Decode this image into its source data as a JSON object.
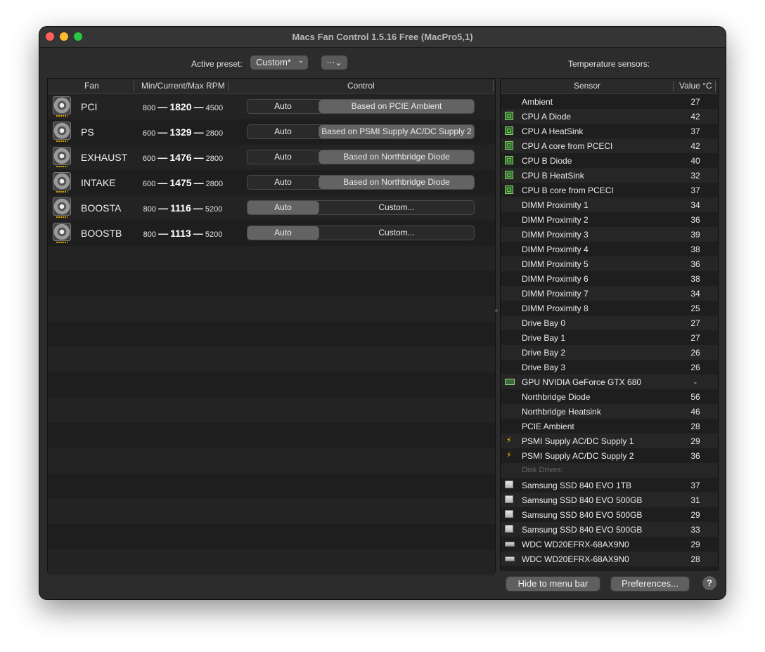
{
  "window": {
    "title": "Macs Fan Control 1.5.16 Free (MacPro5,1)"
  },
  "toolbar": {
    "active_preset_label": "Active preset:",
    "preset_value": "Custom*",
    "more_icon": "ellipsis-circle-icon",
    "temperature_label": "Temperature sensors:"
  },
  "fan_table": {
    "headers": {
      "fan": "Fan",
      "rpm": "Min/Current/Max RPM",
      "control": "Control"
    },
    "dash": "—",
    "fans": [
      {
        "name": "PCI",
        "min": "800",
        "current": "1820",
        "max": "4500",
        "auto_label": "Auto",
        "control_label": "Based on PCIE Ambient",
        "active": "sensor"
      },
      {
        "name": "PS",
        "min": "600",
        "current": "1329",
        "max": "2800",
        "auto_label": "Auto",
        "control_label": "Based on PSMI Supply AC/DC Supply 2",
        "active": "sensor"
      },
      {
        "name": "EXHAUST",
        "min": "600",
        "current": "1476",
        "max": "2800",
        "auto_label": "Auto",
        "control_label": "Based on Northbridge Diode",
        "active": "sensor"
      },
      {
        "name": "INTAKE",
        "min": "600",
        "current": "1475",
        "max": "2800",
        "auto_label": "Auto",
        "control_label": "Based on Northbridge Diode",
        "active": "sensor"
      },
      {
        "name": "BOOSTA",
        "min": "800",
        "current": "1116",
        "max": "5200",
        "auto_label": "Auto",
        "control_label": "Custom...",
        "active": "auto"
      },
      {
        "name": "BOOSTB",
        "min": "800",
        "current": "1113",
        "max": "5200",
        "auto_label": "Auto",
        "control_label": "Custom...",
        "active": "auto"
      }
    ]
  },
  "sensor_table": {
    "headers": {
      "sensor": "Sensor",
      "value": "Value °C"
    },
    "rows": [
      {
        "name": "Ambient",
        "value": "27",
        "icon": ""
      },
      {
        "name": "CPU A Diode",
        "value": "42",
        "icon": "chip"
      },
      {
        "name": "CPU A HeatSink",
        "value": "37",
        "icon": "chip"
      },
      {
        "name": "CPU A core from PCECI",
        "value": "42",
        "icon": "chip"
      },
      {
        "name": "CPU B Diode",
        "value": "40",
        "icon": "chip"
      },
      {
        "name": "CPU B HeatSink",
        "value": "32",
        "icon": "chip"
      },
      {
        "name": "CPU B core from PCECI",
        "value": "37",
        "icon": "chip"
      },
      {
        "name": "DIMM Proximity 1",
        "value": "34",
        "icon": ""
      },
      {
        "name": "DIMM Proximity 2",
        "value": "36",
        "icon": ""
      },
      {
        "name": "DIMM Proximity 3",
        "value": "39",
        "icon": ""
      },
      {
        "name": "DIMM Proximity 4",
        "value": "38",
        "icon": ""
      },
      {
        "name": "DIMM Proximity 5",
        "value": "36",
        "icon": ""
      },
      {
        "name": "DIMM Proximity 6",
        "value": "38",
        "icon": ""
      },
      {
        "name": "DIMM Proximity 7",
        "value": "34",
        "icon": ""
      },
      {
        "name": "DIMM Proximity 8",
        "value": "25",
        "icon": ""
      },
      {
        "name": "Drive Bay 0",
        "value": "27",
        "icon": ""
      },
      {
        "name": "Drive Bay 1",
        "value": "27",
        "icon": ""
      },
      {
        "name": "Drive Bay 2",
        "value": "26",
        "icon": ""
      },
      {
        "name": "Drive Bay 3",
        "value": "26",
        "icon": ""
      },
      {
        "name": "GPU NVIDIA GeForce GTX 680",
        "value": "-",
        "icon": "gpu"
      },
      {
        "name": "Northbridge Diode",
        "value": "56",
        "icon": ""
      },
      {
        "name": "Northbridge Heatsink",
        "value": "46",
        "icon": ""
      },
      {
        "name": "PCIE Ambient",
        "value": "28",
        "icon": ""
      },
      {
        "name": "PSMI Supply AC/DC Supply 1",
        "value": "29",
        "icon": "bolt"
      },
      {
        "name": "PSMI Supply AC/DC Supply 2",
        "value": "36",
        "icon": "bolt"
      },
      {
        "name": "Disk Drives:",
        "value": "",
        "icon": "",
        "section": true
      },
      {
        "name": "Samsung SSD 840 EVO 1TB",
        "value": "37",
        "icon": "ssd"
      },
      {
        "name": "Samsung SSD 840 EVO 500GB",
        "value": "31",
        "icon": "ssd"
      },
      {
        "name": "Samsung SSD 840 EVO 500GB",
        "value": "29",
        "icon": "ssd"
      },
      {
        "name": "Samsung SSD 840 EVO 500GB",
        "value": "33",
        "icon": "ssd"
      },
      {
        "name": "WDC WD20EFRX-68AX9N0",
        "value": "29",
        "icon": "hdd"
      },
      {
        "name": "WDC WD20EFRX-68AX9N0",
        "value": "28",
        "icon": "hdd"
      }
    ]
  },
  "footer": {
    "hide_label": "Hide to menu bar",
    "preferences_label": "Preferences...",
    "help_label": "?"
  }
}
